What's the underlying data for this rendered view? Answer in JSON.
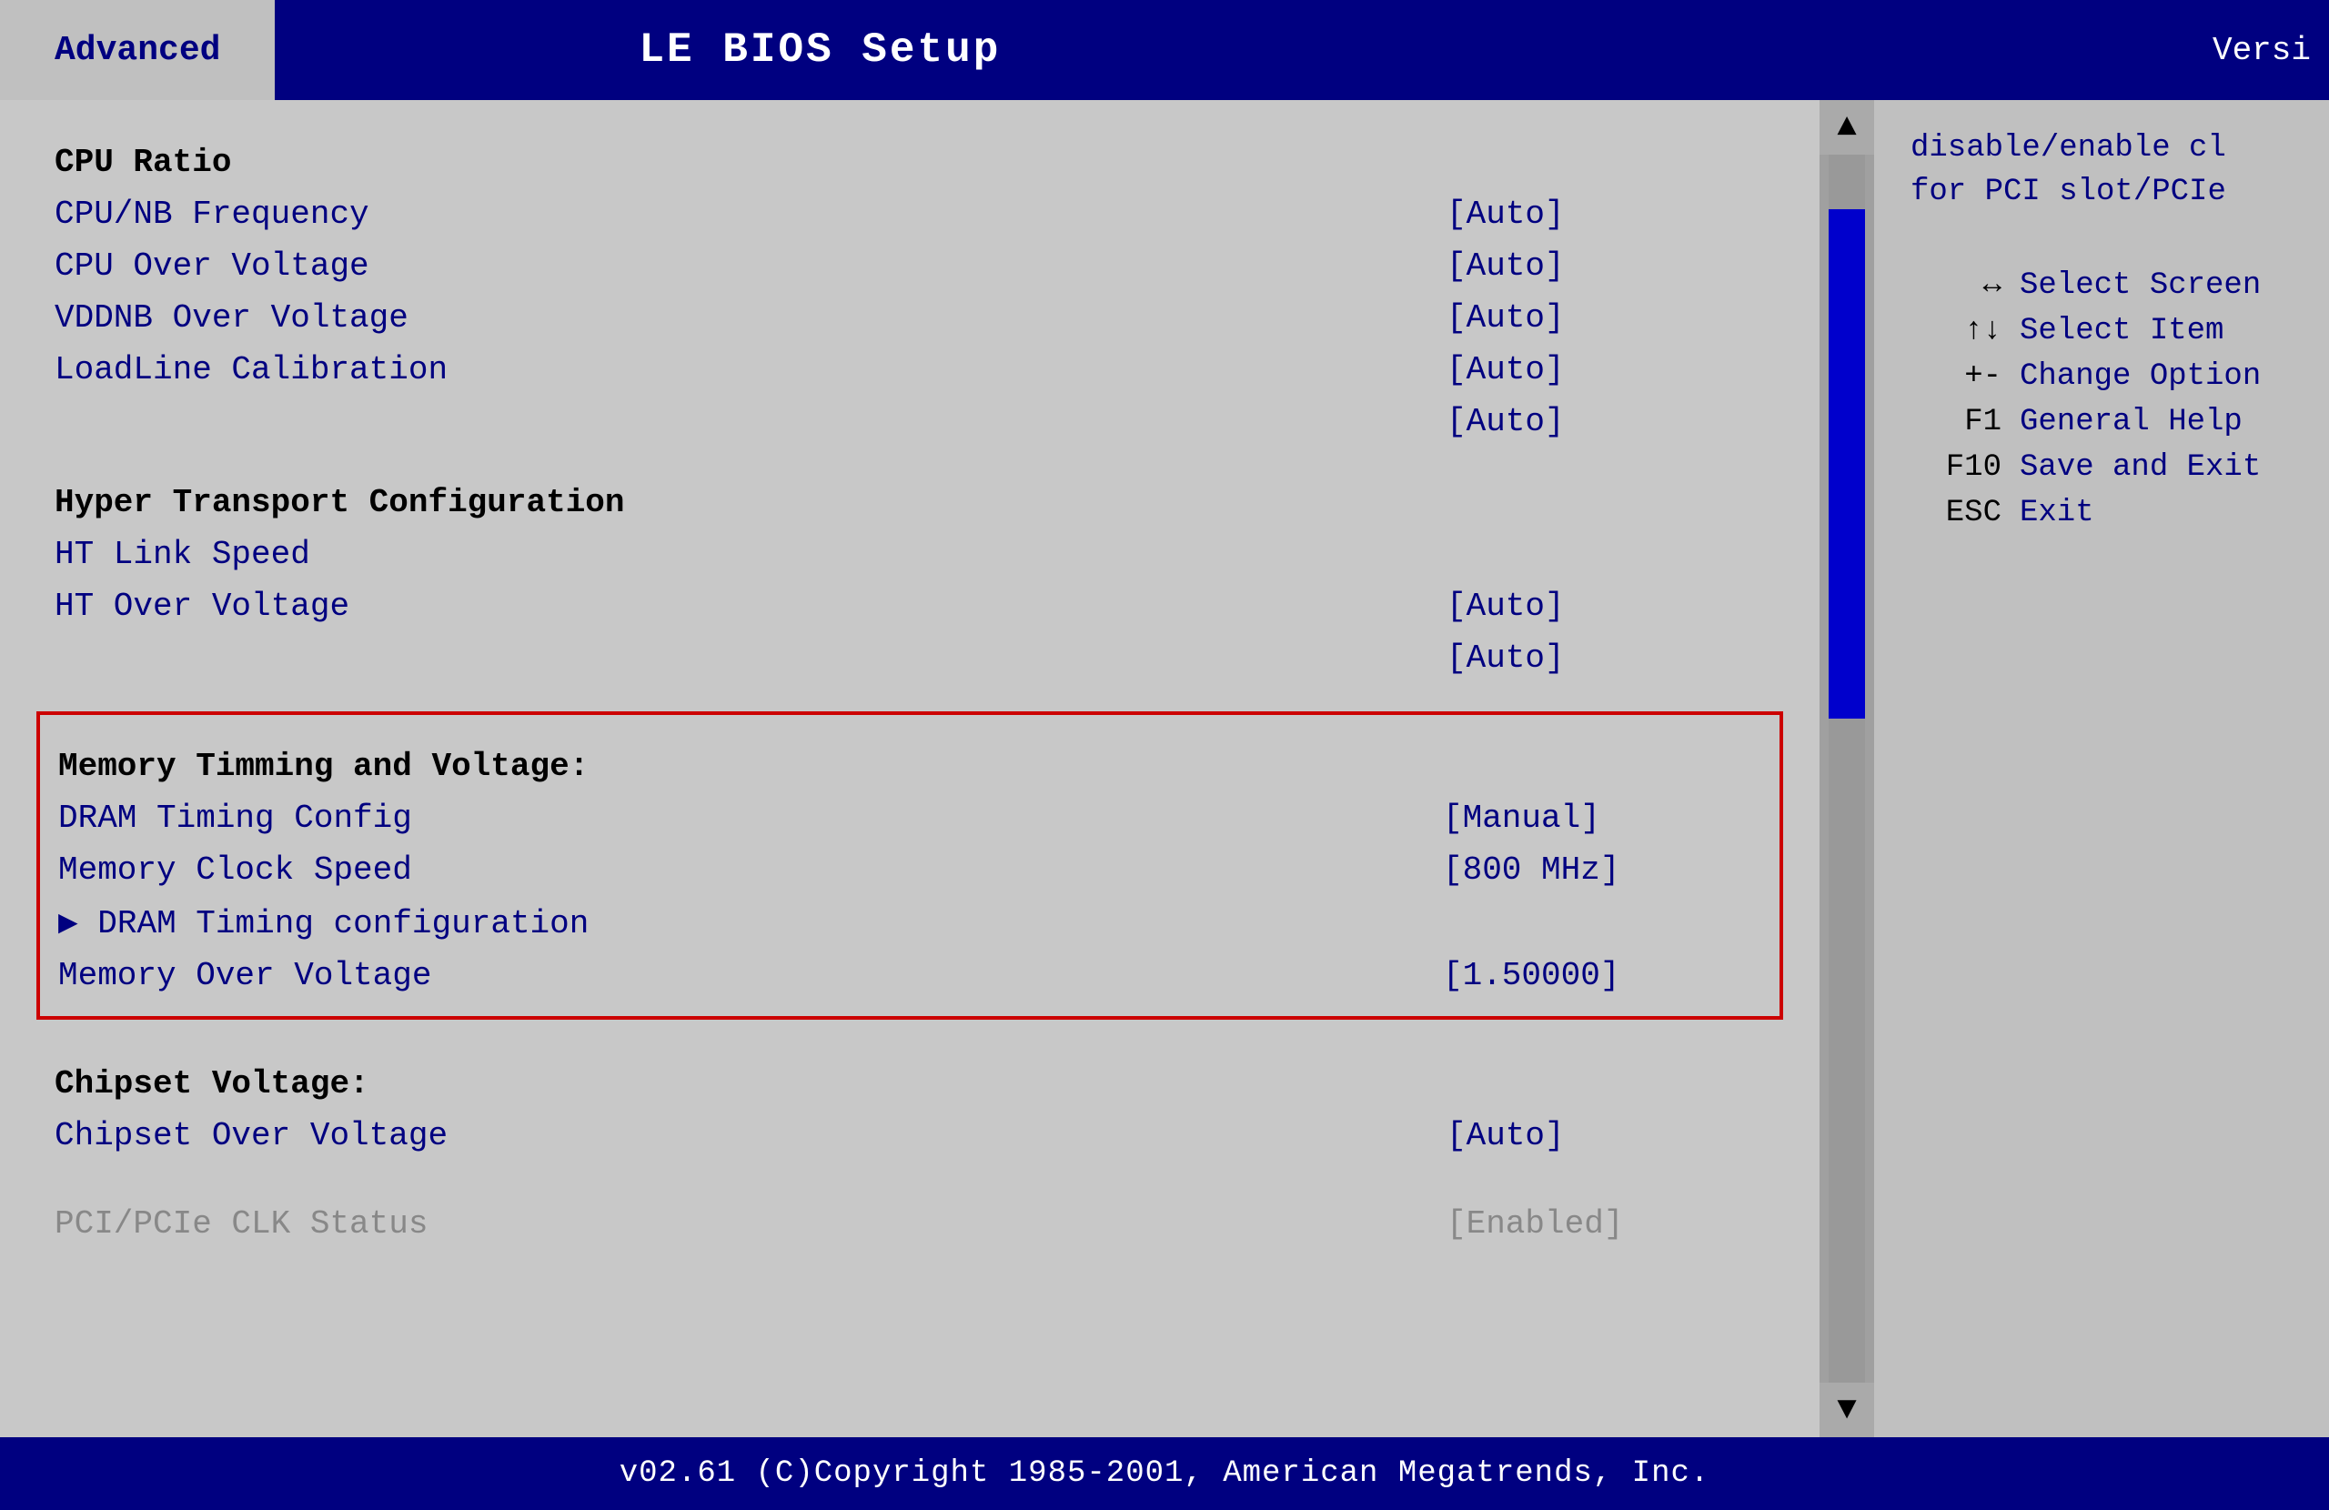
{
  "header": {
    "tab_label": "Advanced",
    "title": "LE BIOS Setup",
    "version_label": "Versi"
  },
  "menu": {
    "items": [
      {
        "label": "CPU Ratio",
        "value": ""
      },
      {
        "label": "CPU/NB Frequency",
        "value": "[Auto]"
      },
      {
        "label": "CPU Over Voltage",
        "value": "[Auto]"
      },
      {
        "label": "VDDNB Over Voltage",
        "value": "[Auto]"
      },
      {
        "label": "LoadLine Calibration",
        "value": "[Auto]"
      },
      {
        "label": "",
        "value": "[Auto]"
      }
    ],
    "hyper_transport_header": "Hyper Transport Configuration",
    "ht_items": [
      {
        "label": "HT Link Speed",
        "value": ""
      },
      {
        "label": "HT Over Voltage",
        "value": "[Auto]"
      },
      {
        "label": "",
        "value": "[Auto]"
      }
    ],
    "memory_header": "Memory Timming and Voltage:",
    "memory_items": [
      {
        "label": "DRAM Timing Config",
        "value": "[Manual]"
      },
      {
        "label": "Memory Clock Speed",
        "value": "[800 MHz]"
      },
      {
        "label": "▶ DRAM Timing configuration",
        "value": ""
      },
      {
        "label": "Memory Over Voltage",
        "value": "[1.50000]"
      }
    ],
    "chipset_header": "Chipset Voltage:",
    "chipset_items": [
      {
        "label": "Chipset Over Voltage",
        "value": "[Auto]"
      }
    ],
    "pci_items": [
      {
        "label": "PCI/PCIe CLK Status",
        "value": "[Enabled]"
      }
    ]
  },
  "help": {
    "description_line1": "disable/enable cl",
    "description_line2": "for PCI slot/PCIe"
  },
  "keyboard": {
    "keys": [
      {
        "key": "↔",
        "desc": "Select Screen"
      },
      {
        "key": "↑↓",
        "desc": "Select Item"
      },
      {
        "key": "+-",
        "desc": "Change Option"
      },
      {
        "key": "F1",
        "desc": "General Help"
      },
      {
        "key": "F10",
        "desc": "Save and Exit"
      },
      {
        "key": "ESC",
        "desc": "Exit"
      }
    ]
  },
  "footer": {
    "text": "v02.61  (C)Copyright 1985-2001, American Megatrends, Inc."
  }
}
